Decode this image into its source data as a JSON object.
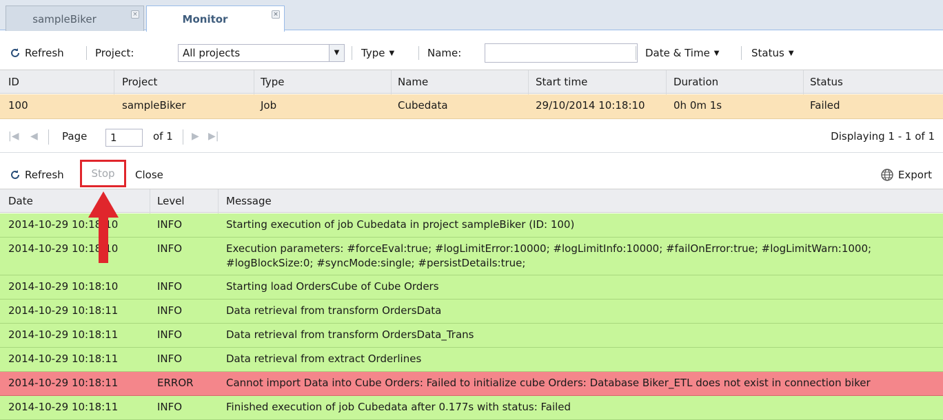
{
  "tabs": [
    {
      "label": "sampleBiker",
      "active": false
    },
    {
      "label": "Monitor",
      "active": true
    }
  ],
  "job_toolbar": {
    "refresh": "Refresh",
    "project_label": "Project:",
    "project_value": "All projects",
    "type": "Type",
    "name_label": "Name:",
    "name_value": "",
    "datetime": "Date & Time",
    "status": "Status"
  },
  "job_columns": [
    "ID",
    "Project",
    "Type",
    "Name",
    "Start time",
    "Duration",
    "Status"
  ],
  "jobs": [
    {
      "id": "100",
      "project": "sampleBiker",
      "type": "Job",
      "name": "Cubedata",
      "start": "29/10/2014 10:18:10",
      "duration": "0h 0m 1s",
      "status": "Failed"
    }
  ],
  "pager": {
    "page_label": "Page",
    "page_value": "1",
    "of": "of 1",
    "displaying": "Displaying 1 - 1 of 1"
  },
  "log_toolbar": {
    "refresh": "Refresh",
    "stop": "Stop",
    "close": "Close",
    "export": "Export"
  },
  "log_columns": [
    "Date",
    "Level",
    "Message"
  ],
  "logs": [
    {
      "date": "2014-10-29 10:18:10",
      "level": "INFO",
      "message": "Starting execution of job Cubedata in project sampleBiker (ID: 100)"
    },
    {
      "date": "2014-10-29 10:18:10",
      "level": "INFO",
      "message": "Execution parameters: #forceEval:true; #logLimitError:10000; #logLimitInfo:10000; #failOnError:true; #logLimitWarn:1000;",
      "message2": "#logBlockSize:0; #syncMode:single; #persistDetails:true;"
    },
    {
      "date": "2014-10-29 10:18:10",
      "level": "INFO",
      "message": "Starting load OrdersCube of Cube Orders"
    },
    {
      "date": "2014-10-29 10:18:11",
      "level": "INFO",
      "message": "Data retrieval from transform OrdersData"
    },
    {
      "date": "2014-10-29 10:18:11",
      "level": "INFO",
      "message": "Data retrieval from transform OrdersData_Trans"
    },
    {
      "date": "2014-10-29 10:18:11",
      "level": "INFO",
      "message": "Data retrieval from extract Orderlines"
    },
    {
      "date": "2014-10-29 10:18:11",
      "level": "ERROR",
      "message": "Cannot import Data into Cube Orders: Failed to initialize cube Orders: Database Biker_ETL does not exist in connection biker"
    },
    {
      "date": "2014-10-29 10:18:11",
      "level": "INFO",
      "message": "Finished execution of job Cubedata after 0.177s with status: Failed"
    }
  ],
  "colors": {
    "selected_row": "#fbe3b8",
    "info_row": "#c7f69a",
    "error_row": "#f4868b",
    "highlight": "#e0262c"
  },
  "icons": [
    "refresh-icon",
    "close-icon",
    "chevron-down-icon",
    "first-page-icon",
    "prev-page-icon",
    "next-page-icon",
    "last-page-icon",
    "globe-icon",
    "arrow-up-icon"
  ]
}
